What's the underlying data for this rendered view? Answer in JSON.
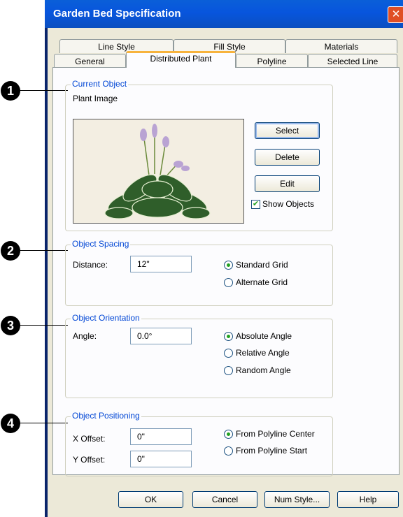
{
  "window": {
    "title": "Garden Bed Specification",
    "close_glyph": "✕"
  },
  "tabs": {
    "row1": [
      "Line Style",
      "Fill Style",
      "Materials"
    ],
    "row2": [
      "General",
      "Distributed Plant",
      "Polyline",
      "Selected Line"
    ]
  },
  "callouts": [
    "1",
    "2",
    "3",
    "4"
  ],
  "current_object": {
    "legend": "Current Object",
    "plant_label": "Plant Image",
    "select": "Select",
    "delete": "Delete",
    "edit": "Edit",
    "show_objects": "Show Objects",
    "show_objects_checked": true,
    "check_glyph": "✔"
  },
  "object_spacing": {
    "legend": "Object Spacing",
    "distance_label": "Distance:",
    "distance_value": "12\"",
    "standard_grid": "Standard Grid",
    "alternate_grid": "Alternate Grid",
    "selected": "standard_grid"
  },
  "object_orientation": {
    "legend": "Object Orientation",
    "angle_label": "Angle:",
    "angle_value": "0.0°",
    "absolute": "Absolute Angle",
    "relative": "Relative Angle",
    "random": "Random Angle",
    "selected": "absolute"
  },
  "object_positioning": {
    "legend": "Object Positioning",
    "x_label": "X Offset:",
    "x_value": "0\"",
    "y_label": "Y Offset:",
    "y_value": "0\"",
    "center": "From Polyline Center",
    "start": "From Polyline Start",
    "selected": "center"
  },
  "footer": {
    "ok": "OK",
    "cancel": "Cancel",
    "num_style": "Num Style...",
    "help": "Help"
  },
  "icons": [
    "close-icon",
    "plant-preview-image",
    "checkbox-check-icon"
  ],
  "colors": {
    "title_bar": "#0855dd",
    "client": "#ece9d8",
    "legend_text": "#0046d5",
    "active_tab_accent": "#f7b33d",
    "close": "#e04f25"
  }
}
